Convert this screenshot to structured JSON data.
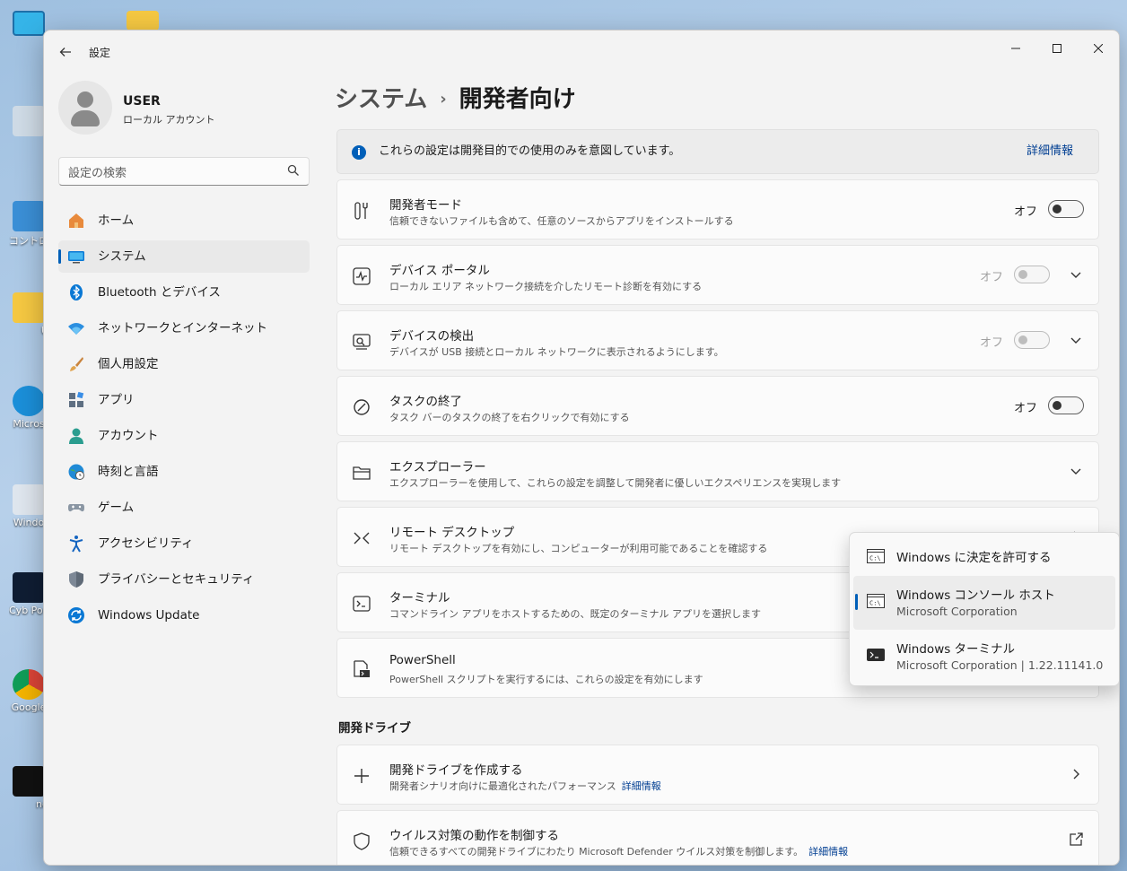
{
  "desktop": {
    "icons": [
      {
        "label": "コントロー"
      },
      {
        "label": "U"
      },
      {
        "label": "Micros"
      },
      {
        "label": "Windo"
      },
      {
        "label": "Cyb Powe"
      },
      {
        "label": "Google"
      },
      {
        "label": "nd"
      }
    ]
  },
  "window": {
    "title": "設定",
    "controls": {
      "minimize": "—",
      "maximize": "☐",
      "close": "✕"
    }
  },
  "profile": {
    "name": "USER",
    "account_type": "ローカル アカウント"
  },
  "search": {
    "placeholder": "設定の検索"
  },
  "sidebar": {
    "items": [
      {
        "label": "ホーム",
        "icon": "home-icon"
      },
      {
        "label": "システム",
        "icon": "system-icon",
        "active": true
      },
      {
        "label": "Bluetooth とデバイス",
        "icon": "bluetooth-icon"
      },
      {
        "label": "ネットワークとインターネット",
        "icon": "wifi-icon"
      },
      {
        "label": "個人用設定",
        "icon": "brush-icon"
      },
      {
        "label": "アプリ",
        "icon": "apps-icon"
      },
      {
        "label": "アカウント",
        "icon": "account-icon"
      },
      {
        "label": "時刻と言語",
        "icon": "globe-clock-icon"
      },
      {
        "label": "ゲーム",
        "icon": "gamepad-icon"
      },
      {
        "label": "アクセシビリティ",
        "icon": "accessibility-icon"
      },
      {
        "label": "プライバシーとセキュリティ",
        "icon": "shield-icon"
      },
      {
        "label": "Windows Update",
        "icon": "update-icon"
      }
    ]
  },
  "breadcrumb": {
    "parent": "システム",
    "separator": "›",
    "current": "開発者向け"
  },
  "info_bar": {
    "text": "これらの設定は開発目的での使用のみを意図しています。",
    "link": "詳細情報"
  },
  "settings": [
    {
      "title": "開発者モード",
      "subtitle": "信頼できないファイルも含めて、任意のソースからアプリをインストールする",
      "toggle_label": "オフ"
    },
    {
      "title": "デバイス ポータル",
      "subtitle": "ローカル エリア ネットワーク接続を介したリモート診断を有効にする",
      "toggle_label": "オフ"
    },
    {
      "title": "デバイスの検出",
      "subtitle": "デバイスが USB 接続とローカル ネットワークに表示されるようにします。",
      "toggle_label": "オフ"
    },
    {
      "title": "タスクの終了",
      "subtitle": "タスク バーのタスクの終了を右クリックで有効にする",
      "toggle_label": "オフ"
    },
    {
      "title": "エクスプローラー",
      "subtitle": "エクスプローラーを使用して、これらの設定を調整して開発者に優しいエクスペリエンスを実現します"
    },
    {
      "title": "リモート デスクトップ",
      "subtitle": "リモート デスクトップを有効にし、コンピューターが利用可能であることを確認する"
    },
    {
      "title": "ターミナル",
      "subtitle": "コマンドライン アプリをホストするための、既定のターミナル アプリを選択します"
    },
    {
      "title": "PowerShell",
      "subtitle": "PowerShell スクリプトを実行するには、これらの設定を有効にします"
    }
  ],
  "dev_drive": {
    "heading": "開発ドライブ",
    "items": [
      {
        "title": "開発ドライブを作成する",
        "subtitle": "開発者シナリオ向けに最適化されたパフォーマンス",
        "link": "詳細情報"
      },
      {
        "title": "ウイルス対策の動作を制御する",
        "subtitle": "信頼できるすべての開発ドライブにわたり Microsoft Defender ウイルス対策を制御します。",
        "link": "詳細情報"
      }
    ]
  },
  "terminal_flyout": {
    "options": [
      {
        "title": "Windows に決定を許可する"
      },
      {
        "title": "Windows コンソール ホスト",
        "subtitle": "Microsoft Corporation",
        "selected": true
      },
      {
        "title": "Windows ターミナル",
        "subtitle": "Microsoft Corporation  |  1.22.11141.0"
      }
    ]
  },
  "colors": {
    "accent": "#005fb8",
    "link": "#003e92",
    "window_bg": "#f3f3f3",
    "card_bg": "#fbfbfb"
  }
}
